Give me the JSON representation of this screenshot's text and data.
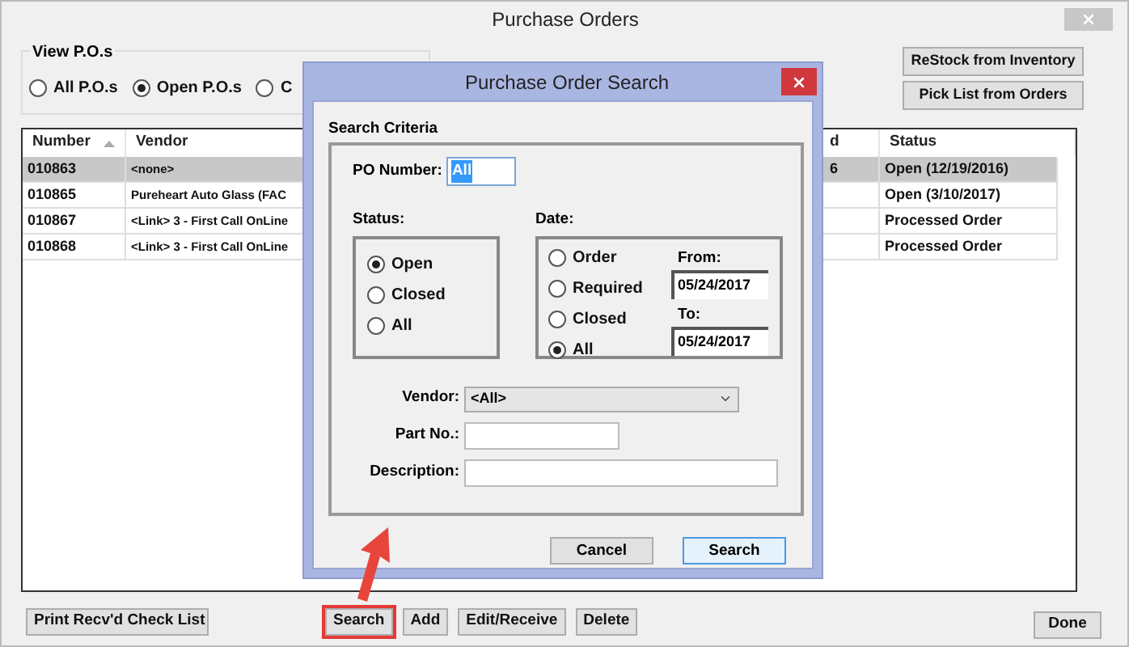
{
  "window": {
    "title": "Purchase Orders"
  },
  "view_group": {
    "title": "View P.O.s",
    "options": [
      {
        "label": "All P.O.s",
        "selected": false
      },
      {
        "label": "Open P.O.s",
        "selected": true
      },
      {
        "label": "C",
        "selected": false
      }
    ]
  },
  "side_buttons": [
    "ReStock from Inventory",
    "Pick List from Orders"
  ],
  "table": {
    "columns": [
      {
        "label": "Number",
        "sorted": true
      },
      {
        "label": "Vendor",
        "sorted": false
      },
      {
        "label": "d",
        "sorted": false
      },
      {
        "label": "Status",
        "sorted": false
      }
    ],
    "rows": [
      {
        "selected": true,
        "cells": [
          "010863",
          "<none>",
          "6",
          "Open (12/19/2016)"
        ]
      },
      {
        "selected": false,
        "cells": [
          "010865",
          "Pureheart Auto Glass (FAC",
          "",
          "Open (3/10/2017)"
        ]
      },
      {
        "selected": false,
        "cells": [
          "010867",
          "<Link> 3 - First Call OnLine",
          "",
          "Processed Order"
        ]
      },
      {
        "selected": false,
        "cells": [
          "010868",
          "<Link> 3 - First Call OnLine",
          "",
          "Processed Order"
        ]
      }
    ]
  },
  "footer_buttons": [
    {
      "label": "Print Recv'd Check List",
      "highlighted": false
    },
    {
      "label": "Search",
      "highlighted": true
    },
    {
      "label": "Add",
      "highlighted": false
    },
    {
      "label": "Edit/Receive",
      "highlighted": false
    },
    {
      "label": "Delete",
      "highlighted": false
    },
    {
      "label": "Done",
      "highlighted": false
    }
  ],
  "dialog": {
    "title": "Purchase Order Search",
    "group_title": "Search Criteria",
    "po_number": {
      "label": "PO Number:",
      "value": "All"
    },
    "status": {
      "label": "Status:",
      "options": [
        {
          "label": "Open",
          "selected": true
        },
        {
          "label": "Closed",
          "selected": false
        },
        {
          "label": "All",
          "selected": false
        }
      ]
    },
    "date": {
      "label": "Date:",
      "options": [
        {
          "label": "Order",
          "selected": false
        },
        {
          "label": "Required",
          "selected": false
        },
        {
          "label": "Closed",
          "selected": false
        },
        {
          "label": "All",
          "selected": true
        }
      ],
      "from": {
        "label": "From:",
        "value": "05/24/2017"
      },
      "to": {
        "label": "To:",
        "value": "05/24/2017"
      }
    },
    "vendor": {
      "label": "Vendor:",
      "value": "<All>"
    },
    "part_no": {
      "label": "Part No.:"
    },
    "description": {
      "label": "Description:"
    },
    "buttons": [
      {
        "label": "Cancel",
        "default": false
      },
      {
        "label": "Search",
        "default": true
      }
    ]
  }
}
